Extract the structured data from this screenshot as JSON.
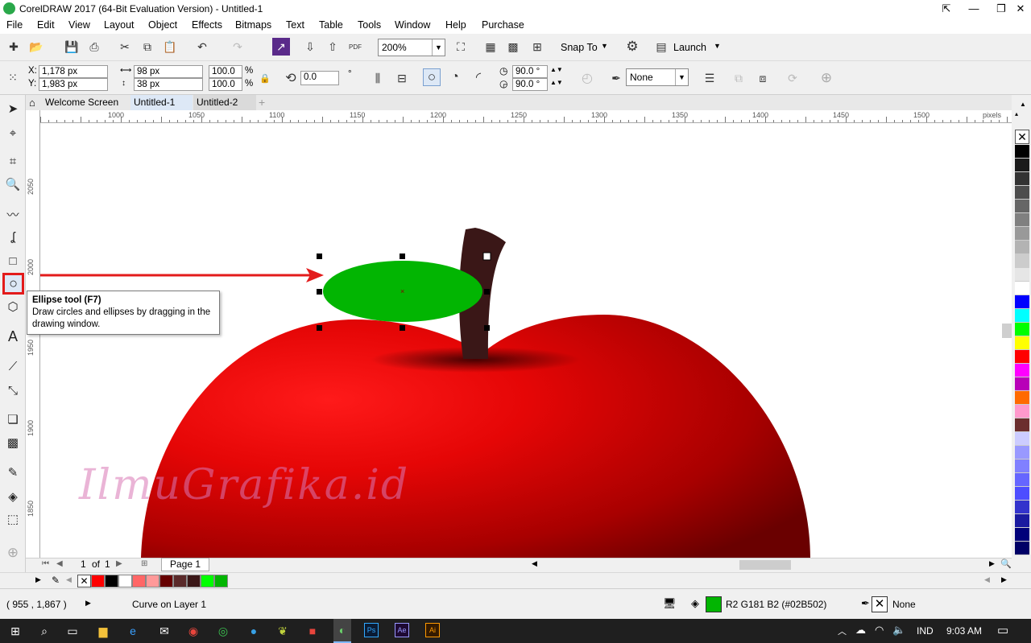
{
  "window": {
    "title": "CorelDRAW 2017 (64-Bit Evaluation Version) - Untitled-1"
  },
  "menu": [
    "File",
    "Edit",
    "View",
    "Layout",
    "Object",
    "Effects",
    "Bitmaps",
    "Text",
    "Table",
    "Tools",
    "Window",
    "Help",
    "Purchase"
  ],
  "toolbar1": {
    "zoom": "200%",
    "snap_label": "Snap To",
    "launch_label": "Launch"
  },
  "toolbar2": {
    "x": "1,178 px",
    "y": "1,983 px",
    "x_label": "X:",
    "y_label": "Y:",
    "w": "98 px",
    "h": "38 px",
    "scale_w": "100.0",
    "scale_h": "100.0",
    "pct": "%",
    "rotation": "0.0",
    "rot_unit": "°",
    "angle1": "90.0 °",
    "angle2": "90.0 °",
    "outline": "None"
  },
  "tabs": [
    "Welcome Screen",
    "Untitled-1",
    "Untitled-2"
  ],
  "ruler_top": [
    "1000",
    "1050",
    "1100",
    "1150",
    "1200",
    "1250",
    "1300",
    "1350",
    "1400",
    "1450",
    "1500"
  ],
  "ruler_unit": "pixels",
  "ruler_left": [
    "2050",
    "2000",
    "1950",
    "1900",
    "1850"
  ],
  "tooltip": {
    "title": "Ellipse tool (F7)",
    "body": "Draw circles and ellipses by dragging in the drawing window."
  },
  "watermark": "IlmuGrafika.id",
  "pagebar": {
    "page_num": "1",
    "of": "of",
    "total": "1",
    "page_tab": "Page 1"
  },
  "status": {
    "coords": "( 955 , 1,867 )",
    "object_info": "Curve on Layer 1",
    "fill_info": "R2 G181 B2 (#02B502)",
    "outline_info": "None"
  },
  "taskbar": {
    "lang": "IND",
    "time": "9:03 AM",
    "apps": [
      "Ps",
      "Ae",
      "Ai"
    ]
  },
  "colors": {
    "fill": "#02b502",
    "apple_light": "#ff1a1a",
    "apple_dark": "#6a0000",
    "stem": "#3a1717",
    "palette": [
      "#ffffff",
      "#000000",
      "#1a1a1a",
      "#333333",
      "#4d4d4d",
      "#666666",
      "#808080",
      "#999999",
      "#b3b3b3",
      "#cccccc",
      "#e6e6e6",
      "#ffffff",
      "#0000ff",
      "#00ffff",
      "#00ff00",
      "#ffff00",
      "#ff0000",
      "#ff00ff",
      "#b800b8",
      "#ff6a00",
      "#ff99cc",
      "#6b2e2e",
      "#ccccff",
      "#9999ff",
      "#8080ff",
      "#6666ff",
      "#4d4dff",
      "#3333cc",
      "#1a1aa0",
      "#00007a",
      "#000066"
    ],
    "doc_palette": [
      "#ff0000",
      "#000000",
      "#ffffff",
      "#ff6666",
      "#ff9999",
      "#660000",
      "#5a2a2a",
      "#3a1717",
      "#00ff00",
      "#02b502"
    ]
  }
}
